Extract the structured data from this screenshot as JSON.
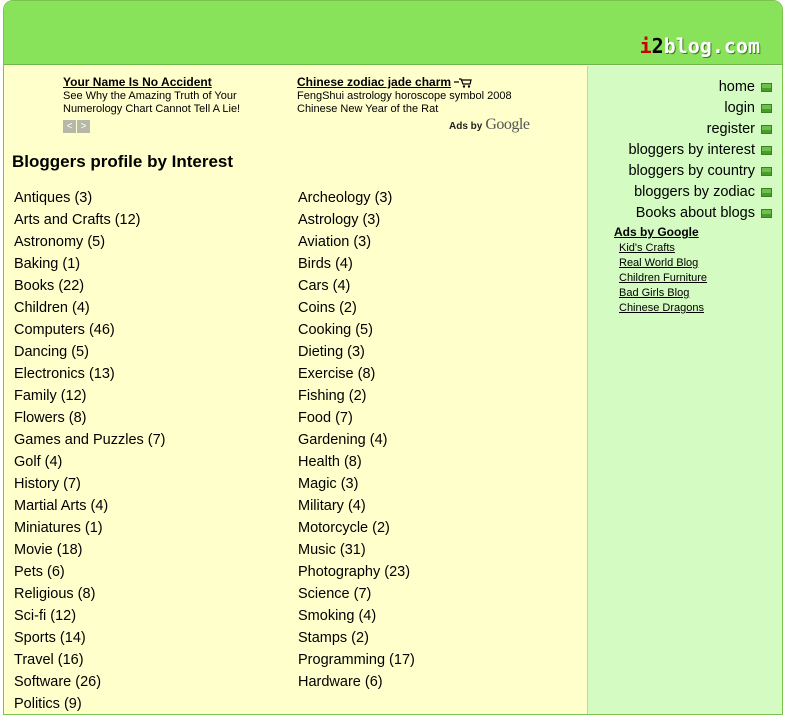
{
  "header": {
    "logo_i": "i",
    "logo_2": "2",
    "logo_rest": "blog.com"
  },
  "ads": {
    "ad1": {
      "title": "Your Name Is No Accident",
      "line1": "See Why the Amazing Truth of Your",
      "line2": "Numerology Chart Cannot Tell A Lie!"
    },
    "ad2": {
      "title": "Chinese zodiac jade charm",
      "line1": "FengShui astrology horoscope symbol 2008",
      "line2": "Chinese New Year of the Rat"
    },
    "nav_prev": "<",
    "nav_next": ">",
    "ads_by": "Ads by",
    "google": "Google"
  },
  "main": {
    "title": "Bloggers profile by Interest",
    "left_column": [
      "Antiques (3)",
      "Arts and Crafts (12)",
      "Astronomy (5)",
      "Baking (1)",
      "Books (22)",
      "Children (4)",
      "Computers (46)",
      "Dancing (5)",
      "Electronics (13)",
      "Family (12)",
      "Flowers (8)",
      "Games and Puzzles (7)",
      "Golf (4)",
      "History (7)",
      "Martial Arts (4)",
      "Miniatures (1)",
      "Movie (18)",
      "Pets (6)",
      "Religious (8)",
      "Sci-fi (12)",
      "Sports (14)",
      "Travel (16)",
      "Software (26)",
      "Politics (9)"
    ],
    "right_column": [
      "Archeology (3)",
      "Astrology (3)",
      "Aviation (3)",
      "Birds (4)",
      "Cars (4)",
      "Coins (2)",
      "Cooking (5)",
      "Dieting (3)",
      "Exercise (8)",
      "Fishing (2)",
      "Food (7)",
      "Gardening (4)",
      "Health (8)",
      "Magic (3)",
      "Military (4)",
      "Motorcycle (2)",
      "Music (31)",
      "Photography (23)",
      "Science (7)",
      "Smoking (4)",
      "Stamps (2)",
      "Programming (17)",
      "Hardware (6)"
    ]
  },
  "sidebar": {
    "nav": [
      "home",
      "login",
      "register",
      "bloggers by interest",
      "bloggers by country",
      "bloggers by zodiac",
      "Books about blogs"
    ],
    "ads_heading": "Ads by Google",
    "ads_links": [
      "Kid's Crafts",
      "Real World Blog",
      "Children Furniture",
      "Bad Girls Blog",
      "Chinese Dragons"
    ]
  },
  "colors": {
    "header_green": "#88e25a",
    "main_bg": "#ffffcc",
    "sidebar_bg": "#d4fcc2",
    "logo_i": "#cc0000"
  }
}
